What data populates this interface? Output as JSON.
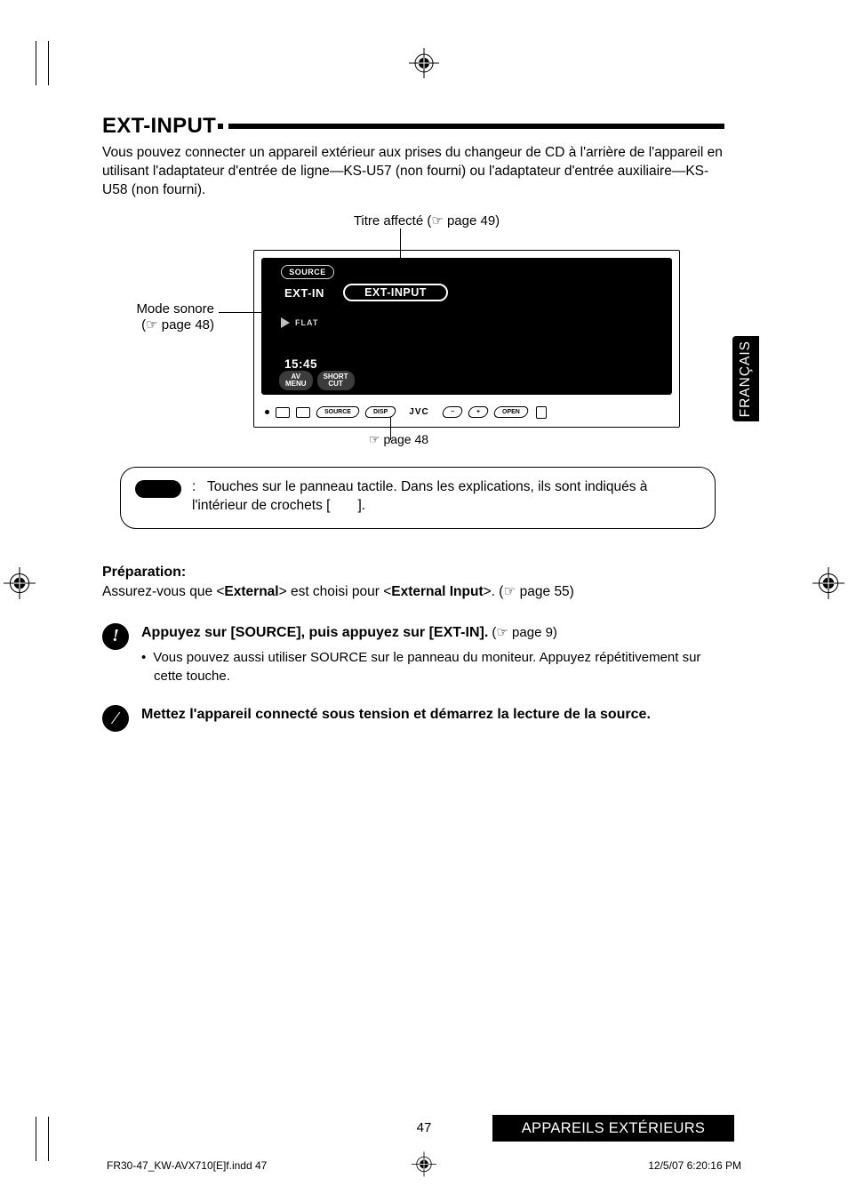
{
  "section": {
    "title": "EXT-INPUT",
    "intro": "Vous pouvez connecter un appareil extérieur aux prises du changeur de CD à l'arrière de l'appareil en utilisant l'adaptateur d'entrée de ligne—KS-U57 (non fourni) ou l'adaptateur d'entrée auxiliaire—KS-U58 (non fourni)."
  },
  "diagram": {
    "assigned_title": "Titre affecté (☞ page 49)",
    "mode_sonore_line1": "Mode sonore",
    "mode_sonore_line2": "(☞ page 48)",
    "page48": "☞ page 48",
    "screen": {
      "source_btn": "SOURCE",
      "extin_label": "EXT-IN",
      "extinput_pill": "EXT-INPUT",
      "flat": "FLAT",
      "time": "15:45",
      "chip1_line1": "AV",
      "chip1_line2": "MENU",
      "chip2_line1": "SHORT",
      "chip2_line2": "CUT"
    },
    "panel": {
      "source": "SOURCE",
      "disp": "DISP",
      "jvc": "JVC",
      "minus": "−",
      "plus": "+",
      "open": "OPEN"
    }
  },
  "note": {
    "colon": ":",
    "text": "Touches sur le panneau tactile. Dans les explications, ils sont indiqués à l'intérieur de crochets [  ]."
  },
  "prep": {
    "heading": "Préparation:",
    "text_pre": "Assurez-vous que <",
    "text_b1": "External",
    "text_mid": "> est choisi pour <",
    "text_b2": "External Input",
    "text_post": ">. (☞ page 55)"
  },
  "steps": [
    {
      "num": "!",
      "main": "Appuyez sur [SOURCE], puis appuyez sur [EXT-IN].",
      "ref": " (☞ page 9)",
      "sub": "Vous pouvez aussi utiliser SOURCE sur le panneau du moniteur. Appuyez répétitivement sur cette touche."
    },
    {
      "num": "⁄",
      "main": " Mettez l'appareil connecté sous tension et démarrez la lecture de la source.",
      "ref": "",
      "sub": ""
    }
  ],
  "side_tab": "FRANÇAIS",
  "footer": {
    "pagenum": "47",
    "bar": "APPAREILS EXTÉRIEURS",
    "imprint_left": "FR30-47_KW-AVX710[E]f.indd   47",
    "imprint_right": "12/5/07   6:20:16 PM"
  }
}
